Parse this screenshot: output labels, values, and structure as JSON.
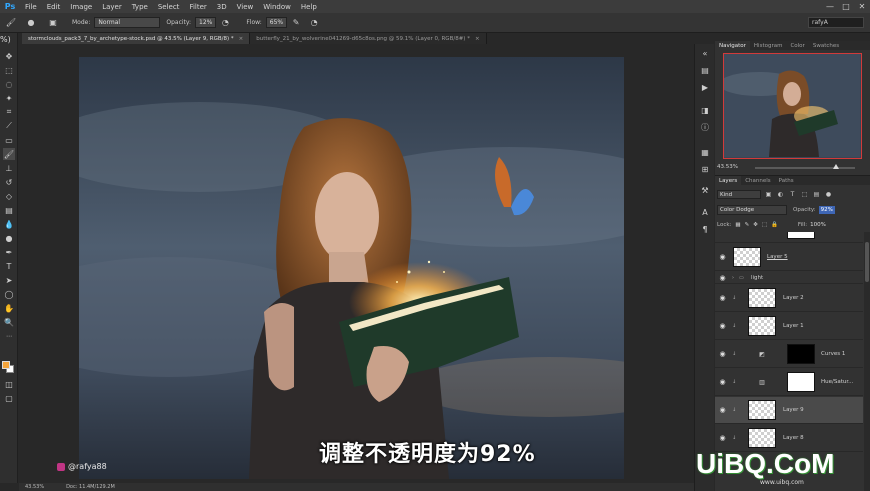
{
  "app": {
    "logo": "Ps"
  },
  "menu": [
    "File",
    "Edit",
    "Image",
    "Layer",
    "Type",
    "Select",
    "Filter",
    "3D",
    "View",
    "Window",
    "Help"
  ],
  "window_controls": [
    "—",
    "□",
    "✕"
  ],
  "options_bar": {
    "mode_label": "Mode:",
    "mode_value": "Normal",
    "opacity_label": "Opacity:",
    "opacity_value": "12%",
    "flow_label": "Flow:",
    "flow_value": "65%",
    "search_value": "rafyA"
  },
  "tabs": [
    {
      "label": "stormclouds_pack3_7_by_archetype-stock.psd @ 43.5% (Layer 9, RGB/8) *",
      "close": "×"
    },
    {
      "label": "butterfly_21_by_wolverine041269-d65c8os.png @ 59.1% (Layer 0, RGB/8#) *",
      "close": "×"
    }
  ],
  "toolbar": {
    "zoom_pct": "%)"
  },
  "canvas": {
    "subtitle": "调整不透明度为92%",
    "watermark_handle": "@rafya88"
  },
  "status": {
    "zoom": "43.53%",
    "doc": "Doc: 11.4M/129.2M"
  },
  "navigator": {
    "tabs": [
      "Navigator",
      "Histogram",
      "Color",
      "Swatches"
    ],
    "zoom": "43.53%"
  },
  "layers_panel": {
    "tabs": [
      "Layers",
      "Channels",
      "Paths"
    ],
    "filter_kind": "Kind",
    "blend_mode": "Color Dodge",
    "opacity_label": "Opacity:",
    "opacity_value": "92%",
    "lock_label": "Lock:",
    "fill_label": "Fill:",
    "fill_value": "100%",
    "layers": [
      {
        "name": "Layer 5",
        "type": "layer"
      },
      {
        "name": "light",
        "type": "group"
      },
      {
        "name": "Layer 2",
        "type": "layer"
      },
      {
        "name": "Layer 1",
        "type": "layer"
      },
      {
        "name": "Curves 1",
        "type": "adjustment"
      },
      {
        "name": "Hue/Satur...",
        "type": "adjustment"
      },
      {
        "name": "Layer 9",
        "type": "layer",
        "selected": true
      },
      {
        "name": "Layer 8",
        "type": "layer"
      }
    ]
  },
  "brand_watermark": {
    "logo": "UiBQ.CoM",
    "url": "www.uibq.com"
  },
  "colors": {
    "foreground": "#f5a53c",
    "background": "#ffffff",
    "accent": "#31a8ff",
    "nav_frame": "#d23a3a"
  }
}
